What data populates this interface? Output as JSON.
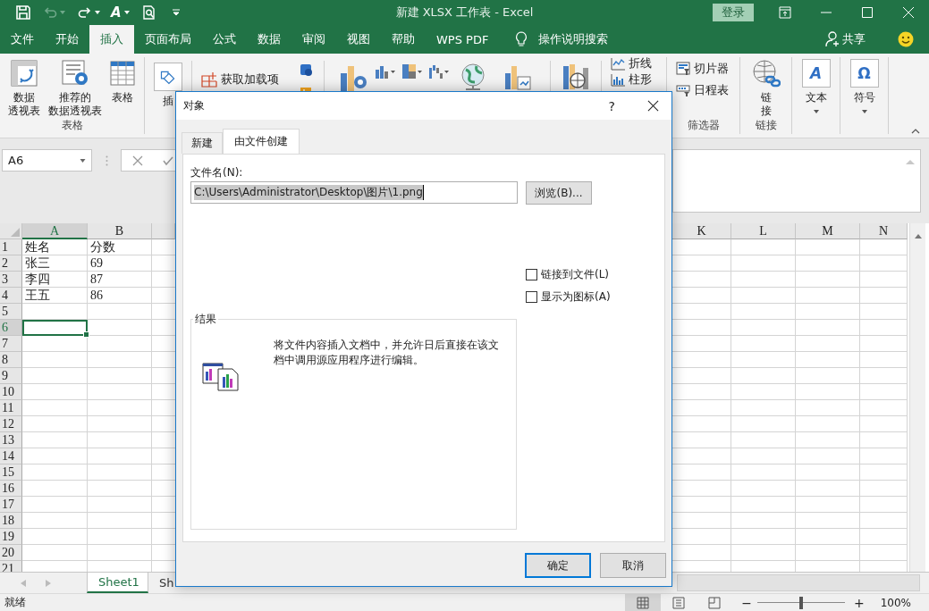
{
  "window": {
    "title": "新建 XLSX 工作表  -  Excel",
    "sign_in": "登录"
  },
  "quick_access": {
    "font_glyph": "A"
  },
  "ribbon_tabs": [
    {
      "label": "文件",
      "selected": false
    },
    {
      "label": "开始",
      "selected": false
    },
    {
      "label": "插入",
      "selected": true
    },
    {
      "label": "页面布局",
      "selected": false
    },
    {
      "label": "公式",
      "selected": false
    },
    {
      "label": "数据",
      "selected": false
    },
    {
      "label": "审阅",
      "selected": false
    },
    {
      "label": "视图",
      "selected": false
    },
    {
      "label": "帮助",
      "selected": false
    },
    {
      "label": "WPS PDF",
      "selected": false
    }
  ],
  "tell_me": "操作说明搜索",
  "share": "共享",
  "ribbon": {
    "tables": {
      "buttons": [
        {
          "lines": [
            "数据",
            "透视表"
          ]
        },
        {
          "lines": [
            "推荐的",
            "数据透视表"
          ]
        },
        {
          "lines": [
            "表格"
          ]
        }
      ],
      "label": "表格"
    },
    "illustrations": "插",
    "get_addins": "获取加载项",
    "sparklines": [
      "折线",
      "柱形"
    ],
    "filters": {
      "buttons": [
        "切片器",
        "日程表"
      ],
      "label": "筛选器"
    },
    "links": {
      "button": {
        "lines": [
          "链",
          "接"
        ]
      },
      "label": "链接"
    },
    "text": {
      "glyph": "A",
      "label": "文本"
    },
    "symbols": {
      "glyph": "Ω",
      "label": "符号"
    }
  },
  "name_box": "A6",
  "grid": {
    "left_columns": [
      {
        "label": "A",
        "selected": true
      },
      {
        "label": "B",
        "selected": false
      }
    ],
    "right_columns": [
      {
        "label": "K"
      },
      {
        "label": "L"
      },
      {
        "label": "M"
      },
      {
        "label": "N"
      }
    ],
    "rows": [
      {
        "number": "1",
        "selected": false,
        "cells": [
          "姓名",
          "分数"
        ]
      },
      {
        "number": "2",
        "selected": false,
        "cells": [
          "张三",
          "69"
        ]
      },
      {
        "number": "3",
        "selected": false,
        "cells": [
          "李四",
          "87"
        ]
      },
      {
        "number": "4",
        "selected": false,
        "cells": [
          "王五",
          "86"
        ]
      },
      {
        "number": "5",
        "selected": false
      },
      {
        "number": "6",
        "selected": true
      },
      {
        "number": "7",
        "selected": false
      },
      {
        "number": "8",
        "selected": false
      },
      {
        "number": "9",
        "selected": false
      },
      {
        "number": "10",
        "selected": false
      },
      {
        "number": "11",
        "selected": false
      },
      {
        "number": "12",
        "selected": false
      },
      {
        "number": "13",
        "selected": false
      },
      {
        "number": "14",
        "selected": false
      },
      {
        "number": "15",
        "selected": false
      },
      {
        "number": "16",
        "selected": false
      },
      {
        "number": "17",
        "selected": false
      },
      {
        "number": "18",
        "selected": false
      },
      {
        "number": "19",
        "selected": false
      },
      {
        "number": "20",
        "selected": false
      },
      {
        "number": "21",
        "selected": false
      }
    ]
  },
  "sheet_tabs": [
    {
      "label": "Sheet1",
      "selected": true
    },
    {
      "label": "Sh",
      "selected": false
    }
  ],
  "status_bar": {
    "text": "就绪",
    "views": [
      {
        "kind": "normal",
        "selected": true
      },
      {
        "kind": "page_layout",
        "selected": false
      },
      {
        "kind": "page_break",
        "selected": false
      }
    ],
    "zoom_out": "−",
    "zoom_slider": {
      "level": 0.5
    },
    "zoom_in": "+",
    "zoom": "100%"
  },
  "dialog": {
    "title": "对象",
    "help": "?",
    "tabs": [
      {
        "label": "新建",
        "selected": false
      },
      {
        "label": "由文件创建",
        "selected": true
      }
    ],
    "file_label": "文件名(N):",
    "file_value": "C:\\Users\\Administrator\\Desktop\\图片\\1.png",
    "browse": "浏览(B)...",
    "checkboxes": [
      {
        "label": "链接到文件(L)",
        "checked": false
      },
      {
        "label": "显示为图标(A)",
        "checked": false
      }
    ],
    "result_title": "结果",
    "result_text": "将文件内容插入文档中，并允许日后直接在该文档中调用源应用程序进行编辑。",
    "buttons": [
      {
        "label": "确定",
        "default": true
      },
      {
        "label": "取消",
        "default": false
      }
    ]
  }
}
